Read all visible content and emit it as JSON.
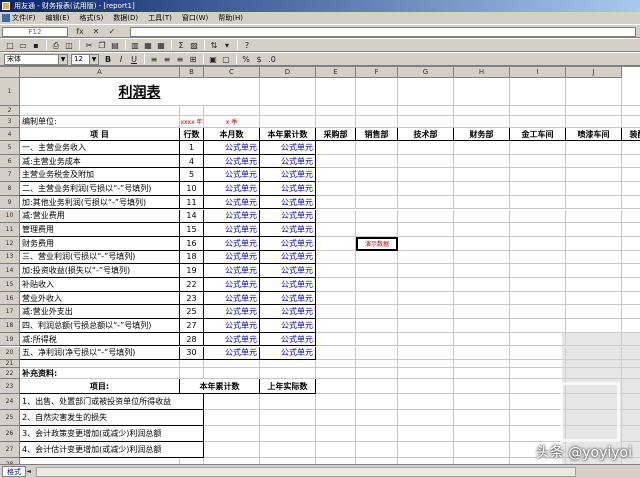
{
  "window": {
    "title": "用友通 - 财务报表(试用版) - [report1]"
  },
  "menu": {
    "items": [
      "文件(F)",
      "编辑(E)",
      "格式(S)",
      "数据(D)",
      "工具(T)",
      "窗口(W)",
      "帮助(H)"
    ]
  },
  "formula": {
    "cell_ref": "F12",
    "cancel": "✕",
    "confirm": "✓",
    "fx": "fx"
  },
  "format_bar": {
    "font_name": "宋体",
    "font_size": "12",
    "bold": "B",
    "italic": "I",
    "underline": "U"
  },
  "columns": [
    "A",
    "B",
    "C",
    "D",
    "E",
    "F",
    "G",
    "H",
    "I",
    "J"
  ],
  "report": {
    "title": "利润表",
    "company_label": "编制单位:",
    "year_label": "xxxx 年",
    "quarter_label": "x 季",
    "headers": [
      "项  目",
      "行数",
      "本月数",
      "本年累计数",
      "采购部",
      "销售部",
      "技术部",
      "财务部",
      "金工车间",
      "喷漆车间",
      "装配车"
    ],
    "formula_cell": "公式单元",
    "demo_cell": "演示数据",
    "rows": [
      {
        "num": "5",
        "item": "一、主营业务收入",
        "line": "1"
      },
      {
        "num": "6",
        "item": "  减:主营业务成本",
        "line": "4"
      },
      {
        "num": "7",
        "item": "      主营业务税金及附加",
        "line": "5"
      },
      {
        "num": "8",
        "item": "二、主营业务利润(亏损以“-”号填列)",
        "line": "10"
      },
      {
        "num": "9",
        "item": "  加:其他业务利润(亏损以“-”号填列)",
        "line": "11"
      },
      {
        "num": "10",
        "item": "  减:营业费用",
        "line": "14"
      },
      {
        "num": "11",
        "item": "      管理费用",
        "line": "15"
      },
      {
        "num": "12",
        "item": "      财务费用",
        "line": "16"
      },
      {
        "num": "13",
        "item": "三、营业利润(亏损以“-”号填列)",
        "line": "18"
      },
      {
        "num": "14",
        "item": "  加:投资收益(损失以“-”号填列)",
        "line": "19"
      },
      {
        "num": "15",
        "item": "      补贴收入",
        "line": "22"
      },
      {
        "num": "16",
        "item": "      营业外收入",
        "line": "23"
      },
      {
        "num": "17",
        "item": "  减:营业外支出",
        "line": "25"
      },
      {
        "num": "18",
        "item": "四、利润总额(亏损总额以“-”号填列)",
        "line": "27"
      },
      {
        "num": "19",
        "item": "  减:所得税",
        "line": "28"
      },
      {
        "num": "20",
        "item": "五、净利润(净亏损以“-”号填列)",
        "line": "30"
      }
    ],
    "supplement_label": "补充资料:",
    "supp_headers": [
      "项目:",
      "本年累计数",
      "上年实际数"
    ],
    "supp_rows": [
      {
        "num": "24",
        "item": "1、出售、处置部门或被投资单位所得收益"
      },
      {
        "num": "25",
        "item": "2、自然灾害发生的损失"
      },
      {
        "num": "26",
        "item": "3、会计政策变更增加(或减少)利润总额"
      },
      {
        "num": "27",
        "item": "4、会计估计变更增加(或减少)利润总额"
      }
    ]
  },
  "sheet": {
    "tab_label": "格式"
  },
  "watermark": "头条 @yoyiyoi"
}
